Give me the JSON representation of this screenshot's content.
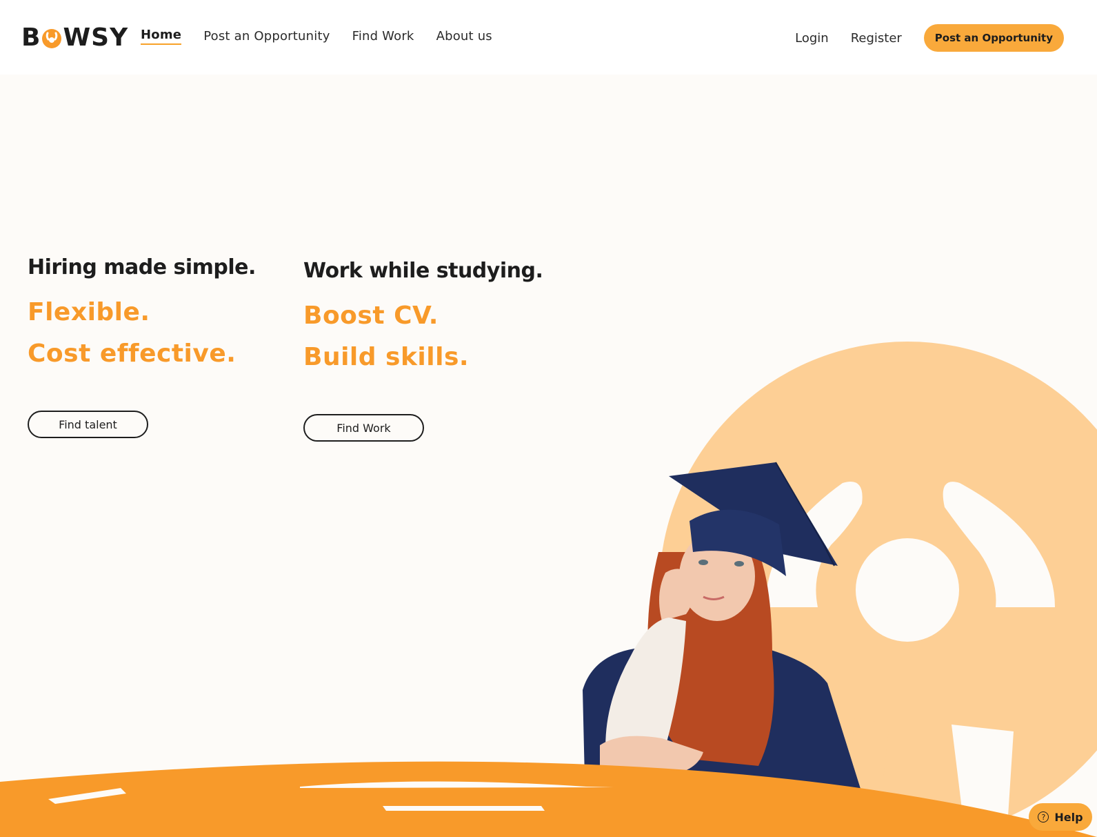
{
  "header": {
    "logo_text_left": "B",
    "logo_text_right": "WSY",
    "nav": [
      {
        "label": "Home"
      },
      {
        "label": "Post an Opportunity"
      },
      {
        "label": "Find Work"
      },
      {
        "label": "About us"
      }
    ],
    "login_label": "Login",
    "register_label": "Register",
    "cta_label": "Post an Opportunity"
  },
  "hero": {
    "employers": {
      "headline": "Hiring made simple.",
      "line1": "Flexible.",
      "line2": "Cost effective.",
      "button_label": "Find talent"
    },
    "students": {
      "headline": "Work while studying.",
      "line1": "Boost CV.",
      "line2": "Build skills.",
      "button_label": "Find Work"
    }
  },
  "help": {
    "label": "Help",
    "icon": "question-circle-icon"
  },
  "colors": {
    "accent": "#f89a2a",
    "accent_light": "#fdcf95",
    "button": "#f9a93b",
    "background": "#fdfbf8",
    "text": "#1d1d1d"
  }
}
